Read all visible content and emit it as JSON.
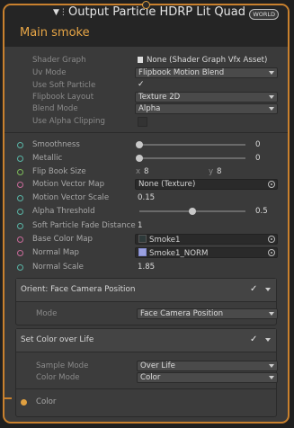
{
  "header": {
    "vfx_icon": "vfx-glyph",
    "title": "Output Particle HDRP Lit Quad",
    "badge": "WORLD",
    "subtitle": "Main smoke"
  },
  "settings": {
    "shader_graph": {
      "label": "Shader Graph",
      "value": "None (Shader Graph Vfx Asset)"
    },
    "uv_mode": {
      "label": "Uv Mode",
      "value": "Flipbook Motion Blend"
    },
    "use_soft_particle": {
      "label": "Use Soft Particle",
      "checked": true
    },
    "flipbook_layout": {
      "label": "Flipbook Layout",
      "value": "Texture 2D"
    },
    "blend_mode": {
      "label": "Blend Mode",
      "value": "Alpha"
    },
    "use_alpha_clipping": {
      "label": "Use Alpha Clipping",
      "checked": false
    }
  },
  "inputs": {
    "smoothness": {
      "label": "Smoothness",
      "value": "0",
      "level": 0
    },
    "metallic": {
      "label": "Metallic",
      "value": "0",
      "level": 0
    },
    "flip_book_size": {
      "label": "Flip Book Size",
      "x_label": "x",
      "x_value": "8",
      "y_label": "y",
      "y_value": "8"
    },
    "motion_vector_map": {
      "label": "Motion Vector Map",
      "value": "None (Texture)"
    },
    "motion_vector_scale": {
      "label": "Motion Vector Scale",
      "value": "0.15"
    },
    "alpha_threshold": {
      "label": "Alpha Threshold",
      "value": "0.5",
      "level": 0.5
    },
    "soft_particle_fade": {
      "label": "Soft Particle Fade Distance",
      "value": "1"
    },
    "base_color_map": {
      "label": "Base Color Map",
      "value": "Smoke1"
    },
    "normal_map": {
      "label": "Normal Map",
      "value": "Smoke1_NORM"
    },
    "normal_scale": {
      "label": "Normal Scale",
      "value": "1.85"
    }
  },
  "block_orient": {
    "title": "Orient: Face Camera Position",
    "enabled": true,
    "mode": {
      "label": "Mode",
      "value": "Face Camera Position"
    }
  },
  "block_color": {
    "title": "Set Color over Life",
    "enabled": true,
    "sample_mode": {
      "label": "Sample Mode",
      "value": "Over Life"
    },
    "color_mode": {
      "label": "Color Mode",
      "value": "Color"
    },
    "color": {
      "label": "Color"
    }
  },
  "colors": {
    "accent": "#c9812e",
    "subtitle": "#e8a646",
    "port_float": "#59b5a6",
    "port_texture": "#c96b9a",
    "port_vector2": "#7dbb5a"
  }
}
